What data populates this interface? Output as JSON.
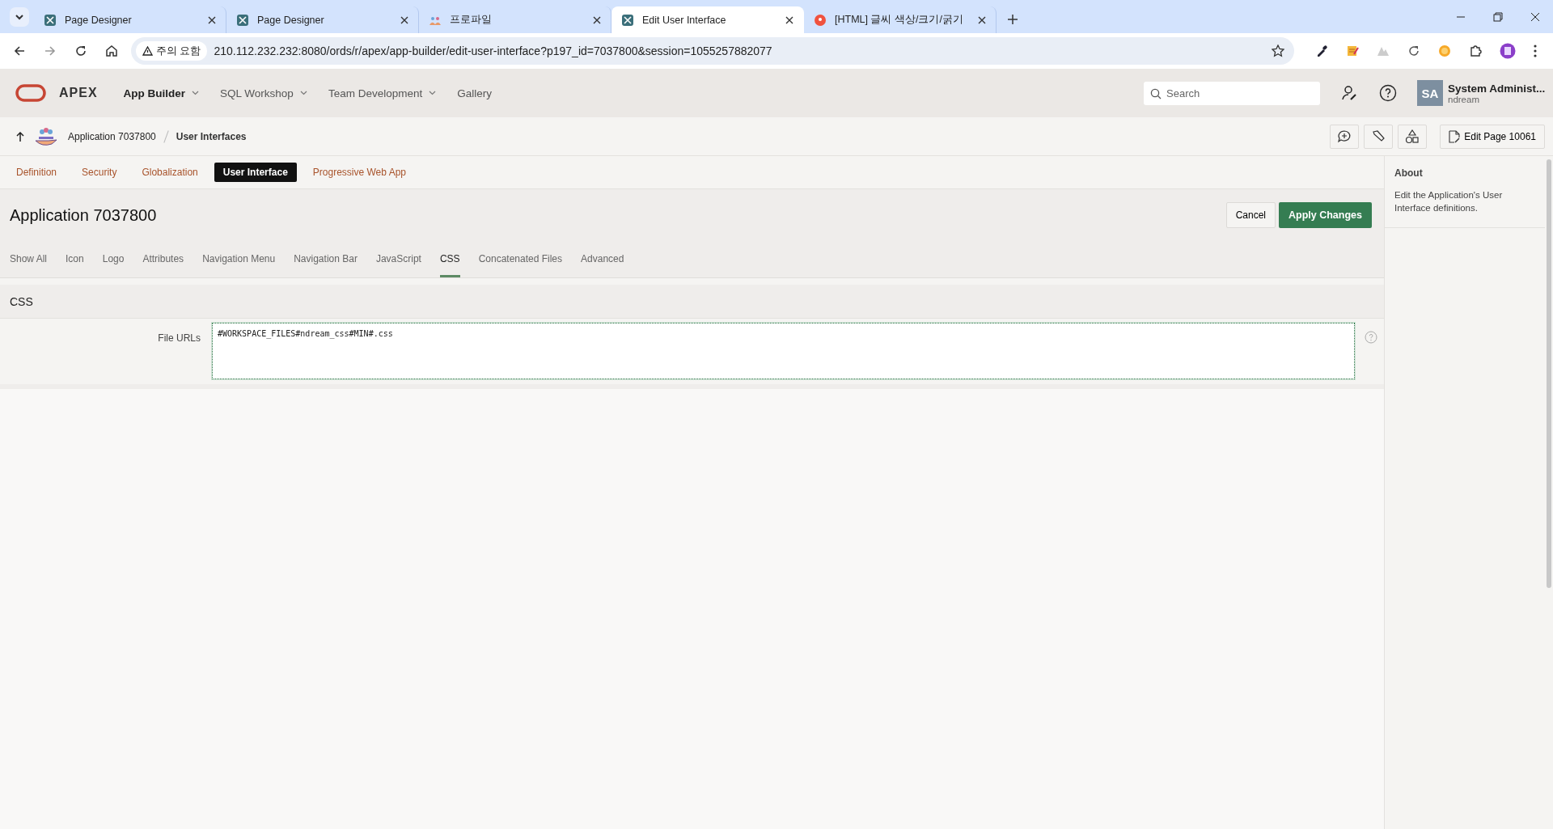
{
  "browser": {
    "tabs": [
      {
        "title": "Page Designer",
        "kind": "apex",
        "selected": false
      },
      {
        "title": "Page Designer",
        "kind": "apex",
        "selected": false
      },
      {
        "title": "프로파일",
        "kind": "people",
        "selected": false
      },
      {
        "title": "Edit User Interface",
        "kind": "apex",
        "selected": true
      },
      {
        "title": "[HTML] 글씨 색상/크기/굵기",
        "kind": "blog",
        "selected": false
      }
    ],
    "security_label": "주의 요함",
    "url": "210.112.232.232:8080/ords/r/apex/app-builder/edit-user-interface?p197_id=7037800&session=1055257882077"
  },
  "header": {
    "brand": "APEX",
    "menus": [
      {
        "label": "App Builder",
        "dropdown": true,
        "selected": true
      },
      {
        "label": "SQL Workshop",
        "dropdown": true,
        "selected": false
      },
      {
        "label": "Team Development",
        "dropdown": true,
        "selected": false
      },
      {
        "label": "Gallery",
        "dropdown": false,
        "selected": false
      }
    ],
    "search": {
      "placeholder": "Search"
    },
    "user": {
      "initials": "SA",
      "name": "System Administ...",
      "workspace": "ndream"
    }
  },
  "breadcrumb": {
    "items": [
      "Application 7037800",
      "User Interfaces"
    ],
    "edit_page_button": "Edit Page 10061"
  },
  "page_tabs": [
    {
      "label": "Definition",
      "selected": false
    },
    {
      "label": "Security",
      "selected": false
    },
    {
      "label": "Globalization",
      "selected": false
    },
    {
      "label": "User Interface",
      "selected": true
    },
    {
      "label": "Progressive Web App",
      "selected": false
    }
  ],
  "title": "Application 7037800",
  "buttons": {
    "cancel": "Cancel",
    "apply": "Apply Changes"
  },
  "section_tabs": [
    {
      "label": "Show All",
      "selected": false
    },
    {
      "label": "Icon",
      "selected": false
    },
    {
      "label": "Logo",
      "selected": false
    },
    {
      "label": "Attributes",
      "selected": false
    },
    {
      "label": "Navigation Menu",
      "selected": false
    },
    {
      "label": "Navigation Bar",
      "selected": false
    },
    {
      "label": "JavaScript",
      "selected": false
    },
    {
      "label": "CSS",
      "selected": true
    },
    {
      "label": "Concatenated Files",
      "selected": false
    },
    {
      "label": "Advanced",
      "selected": false
    }
  ],
  "region": {
    "title": "CSS",
    "fields": [
      {
        "label": "File URLs",
        "value": "#WORKSPACE_FILES#ndream_css#MIN#.css"
      }
    ]
  },
  "about": {
    "title": "About",
    "text": "Edit the Application's User Interface definitions."
  }
}
